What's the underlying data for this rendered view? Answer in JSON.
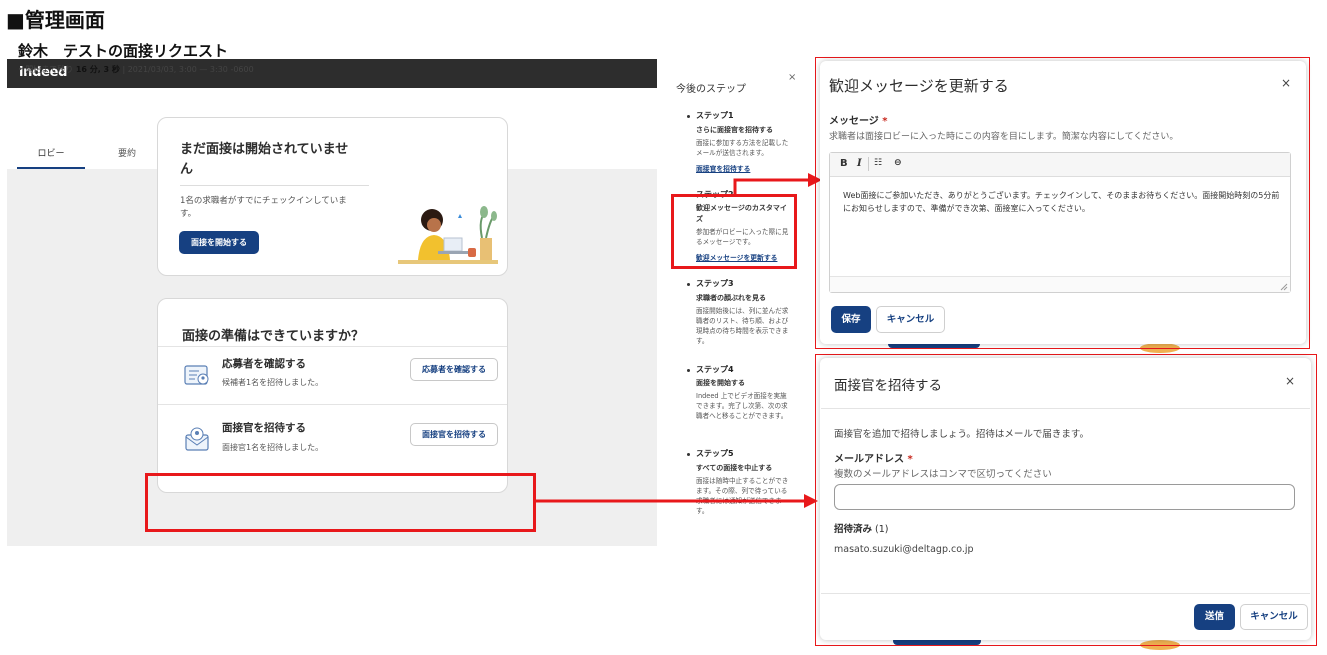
{
  "page": {
    "title": "■管理画面"
  },
  "app": {
    "logo": "indeed",
    "request_title": "鈴木　テストの面接リクエスト",
    "meta_prefix": "• 開始まで残り ",
    "meta_countdown": "16 分, 3 秒",
    "meta_date": " | 2021/03/03, 3:00 — 3:30 -0600",
    "tabs": [
      {
        "label": "ロビー"
      },
      {
        "label": "要約"
      }
    ],
    "status_card": {
      "title": "まだ面接は開始されていません",
      "desc": "1名の求職者がすでにチェックインしています。",
      "button": "面接を開始する"
    },
    "ready_card": {
      "title": "面接の準備はできていますか？",
      "rows": [
        {
          "title": "応募者を確認する",
          "sub": "候補者1名を招待しました。",
          "button": "応募者を確認する"
        },
        {
          "title": "面接官を招待する",
          "sub": "面接官1名を招待しました。",
          "button": "面接官を招待する"
        }
      ]
    }
  },
  "steps": {
    "title": "今後のステップ",
    "close": "×",
    "items": [
      {
        "head": "ステップ1",
        "sub": "さらに面接官を招待する",
        "desc": "面接に参加する方法を記載したメールが送信されます。",
        "link": "面接官を招待する"
      },
      {
        "head": "ステップ2",
        "sub": "歓迎メッセージのカスタマイズ",
        "desc": "参加者がロビーに入った際に見るメッセージです。",
        "link": "歓迎メッセージを更新する"
      },
      {
        "head": "ステップ3",
        "sub": "求職者の顔ぶれを見る",
        "desc": "面接開始後には、列に並んだ求職者のリスト、待ち順、および現時点の待ち時間を表示できます。",
        "link": ""
      },
      {
        "head": "ステップ4",
        "sub": "面接を開始する",
        "desc": "Indeed 上でビデオ面接を実施できます。完了し次第、次の求職者へと移ることができます。",
        "link": ""
      },
      {
        "head": "ステップ5",
        "sub": "すべての面接を中止する",
        "desc": "面接は随時中止することができます。その際、列で待っている求職者には通知が送信できます。",
        "link": ""
      }
    ]
  },
  "welcome_modal": {
    "title": "歓迎メッセージを更新する",
    "close": "×",
    "label": "メッセージ",
    "required": "*",
    "hint": "求職者は面接ロビーに入った時にこの内容を目にします。簡潔な内容にしてください。",
    "toolbar": {
      "bold": "B",
      "italic": "I",
      "list": "☷",
      "link": "⊖"
    },
    "message": "Web面接にご参加いただき、ありがとうございます。チェックインして、そのままお待ちください。面接開始時刻の5分前にお知らせしますので、準備ができ次第、面接室に入ってください。",
    "save": "保存",
    "cancel": "キャンセル"
  },
  "invite_modal": {
    "title": "面接官を招待する",
    "close": "×",
    "desc": "面接官を追加で招待しましょう。招待はメールで届きます。",
    "label": "メールアドレス",
    "required": "*",
    "hint": "複数のメールアドレスはコンマで区切ってください",
    "input_value": "",
    "invited_label": "招待済み",
    "invited_count": "(1)",
    "invited_email": "masato.suzuki@deltagp.co.jp",
    "send": "送信",
    "cancel": "キャンセル"
  },
  "colors": {
    "accent": "#164081",
    "highlight": "#e8181b",
    "topbar": "#2d2d2d"
  }
}
